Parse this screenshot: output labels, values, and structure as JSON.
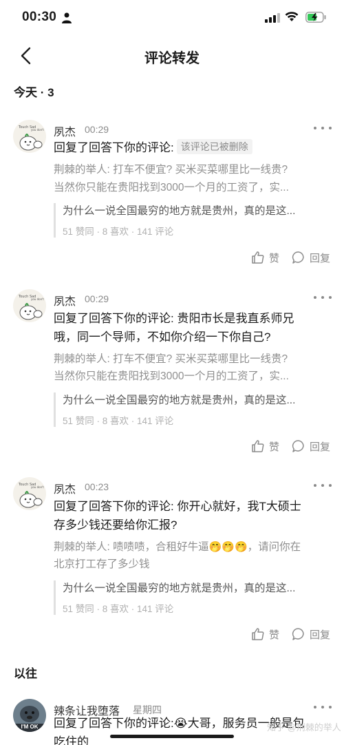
{
  "status_bar": {
    "time": "00:30"
  },
  "nav": {
    "title": "评论转发"
  },
  "today": {
    "label": "今天 · 3"
  },
  "items": [
    {
      "author": "夙杰",
      "time": "00:29",
      "reply": "回复了回答下你的评论:",
      "deleted_tag": "该评论已被删除",
      "quote_line1": "荆棘的举人: 打车不便宜? 买米买菜哪里比一线贵?",
      "quote_line2": "当然你只能在贵阳找到3000一个月的工资了，实...",
      "orig_title": "为什么一说全国最穷的地方就是贵州，真的是这...",
      "orig_stats": "51 赞同 · 8 喜欢 · 141 评论",
      "like_label": "赞",
      "reply_label": "回复"
    },
    {
      "author": "夙杰",
      "time": "00:29",
      "reply_line1": "回复了回答下你的评论: 贵阳市长是我直系师兄",
      "reply_line2": "哦，同一个导师，不如你介绍一下你自己?",
      "quote_line1": "荆棘的举人: 打车不便宜? 买米买菜哪里比一线贵?",
      "quote_line2": "当然你只能在贵阳找到3000一个月的工资了，实...",
      "orig_title": "为什么一说全国最穷的地方就是贵州，真的是这...",
      "orig_stats": "51 赞同 · 8 喜欢 · 141 评论",
      "like_label": "赞",
      "reply_label": "回复"
    },
    {
      "author": "夙杰",
      "time": "00:23",
      "reply_line1": "回复了回答下你的评论: 你开心就好，我T大硕士",
      "reply_line2": "存多少钱还要给你汇报?",
      "quote_line1_a": "荆棘的举人: 啧啧啧，合租好牛逼",
      "quote_line1_emoji": "🤭🤭🤭",
      "quote_line1_b": "，请问你在",
      "quote_line2": "北京打工存了多少钱",
      "orig_title": "为什么一说全国最穷的地方就是贵州，真的是这...",
      "orig_stats": "51 赞同 · 8 喜欢 · 141 评论",
      "like_label": "赞",
      "reply_label": "回复"
    }
  ],
  "past": {
    "label": "以往",
    "item": {
      "author": "辣条让我堕落",
      "time": "星期四",
      "avatar_text": "I'M OK",
      "reply_a": "回复了回答下你的评论:",
      "reply_emoji": "😭",
      "reply_b": "大哥，服务员一般是包",
      "reply_line2": "吃住的"
    }
  },
  "watermark": "知乎 @荆棘的举人"
}
